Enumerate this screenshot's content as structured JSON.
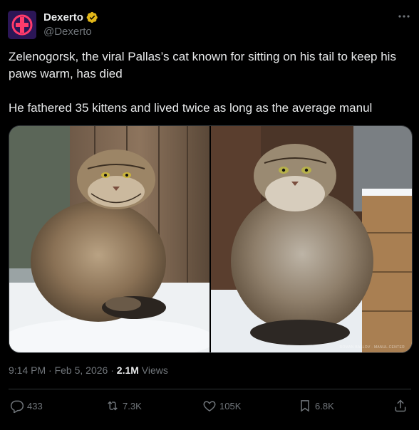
{
  "author": {
    "name": "Dexerto",
    "handle": "@Dexerto",
    "verified_badge": "verified-badge-icon",
    "avatar_icon": "dexerto-logo-icon"
  },
  "tweet": {
    "paragraph_1": "Zelenogorsk, the viral Pallas’s cat known for sitting on his tail to keep his paws warm, has died",
    "paragraph_2": "He fathered 35 kittens and lived twice as long as the average manul"
  },
  "media": {
    "photo_credit": "ROMAN BALLOV · MANUL.CENTER"
  },
  "meta": {
    "time": "9:14 PM",
    "sep1": " · ",
    "date": "Feb 5, 2026",
    "sep2": " · ",
    "views_count": "2.1M",
    "views_label": " Views"
  },
  "actions": {
    "replies": "433",
    "reposts": "7.3K",
    "likes": "105K",
    "bookmarks": "6.8K"
  },
  "colors": {
    "background": "#000000",
    "text_primary": "#e7e9ea",
    "text_secondary": "#71767b",
    "verified_gold": "#e2b719",
    "border": "#2f3336"
  }
}
